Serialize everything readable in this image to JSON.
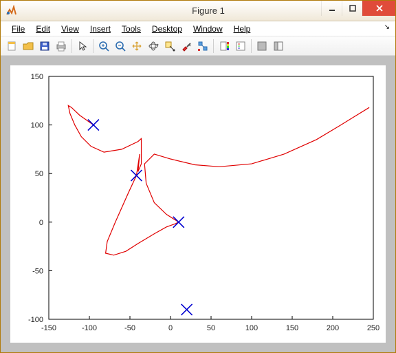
{
  "window": {
    "title": "Figure 1",
    "app_icon": "matlab-icon"
  },
  "menubar": {
    "items": [
      "File",
      "Edit",
      "View",
      "Insert",
      "Tools",
      "Desktop",
      "Window",
      "Help"
    ]
  },
  "toolbar": {
    "groups": [
      [
        "new-figure-icon",
        "open-icon",
        "save-icon",
        "print-icon"
      ],
      [
        "pointer-icon"
      ],
      [
        "zoom-in-icon",
        "zoom-out-icon",
        "pan-icon",
        "rotate3d-icon",
        "data-cursor-icon",
        "brush-icon",
        "link-icon"
      ],
      [
        "colorbar-icon",
        "legend-icon"
      ],
      [
        "hide-tools-icon",
        "dock-icon"
      ]
    ]
  },
  "chart_data": {
    "type": "line",
    "xlim": [
      -150,
      250
    ],
    "ylim": [
      -100,
      150
    ],
    "xticks": [
      -150,
      -100,
      -50,
      0,
      50,
      100,
      150,
      200,
      250
    ],
    "yticks": [
      -100,
      -50,
      0,
      50,
      100,
      150
    ],
    "markers": {
      "symbol": "x",
      "color": "#0000d0",
      "points": [
        {
          "x": -95,
          "y": 100
        },
        {
          "x": -42,
          "y": 48
        },
        {
          "x": 10,
          "y": 0
        },
        {
          "x": 20,
          "y": -90
        }
      ]
    },
    "curve": {
      "color": "#e00000",
      "points": [
        {
          "x": -95,
          "y": 100
        },
        {
          "x": -112,
          "y": 110
        },
        {
          "x": -122,
          "y": 118
        },
        {
          "x": -126,
          "y": 120
        },
        {
          "x": -124,
          "y": 112
        },
        {
          "x": -118,
          "y": 100
        },
        {
          "x": -110,
          "y": 88
        },
        {
          "x": -98,
          "y": 78
        },
        {
          "x": -82,
          "y": 72
        },
        {
          "x": -60,
          "y": 75
        },
        {
          "x": -40,
          "y": 83
        },
        {
          "x": -36,
          "y": 86
        },
        {
          "x": -36,
          "y": 60
        },
        {
          "x": -40,
          "y": 52
        },
        {
          "x": -38,
          "y": 70
        },
        {
          "x": -42,
          "y": 48
        },
        {
          "x": -52,
          "y": 30
        },
        {
          "x": -68,
          "y": 0
        },
        {
          "x": -78,
          "y": -20
        },
        {
          "x": -80,
          "y": -32
        },
        {
          "x": -70,
          "y": -34
        },
        {
          "x": -55,
          "y": -30
        },
        {
          "x": -40,
          "y": -22
        },
        {
          "x": -20,
          "y": -12
        },
        {
          "x": -5,
          "y": -5
        },
        {
          "x": 5,
          "y": -2
        },
        {
          "x": 10,
          "y": 0
        },
        {
          "x": -5,
          "y": 8
        },
        {
          "x": -20,
          "y": 20
        },
        {
          "x": -30,
          "y": 40
        },
        {
          "x": -32,
          "y": 60
        },
        {
          "x": -20,
          "y": 70
        },
        {
          "x": 0,
          "y": 65
        },
        {
          "x": 30,
          "y": 59
        },
        {
          "x": 60,
          "y": 57
        },
        {
          "x": 100,
          "y": 60
        },
        {
          "x": 140,
          "y": 70
        },
        {
          "x": 180,
          "y": 85
        },
        {
          "x": 210,
          "y": 100
        },
        {
          "x": 245,
          "y": 118
        }
      ]
    }
  }
}
